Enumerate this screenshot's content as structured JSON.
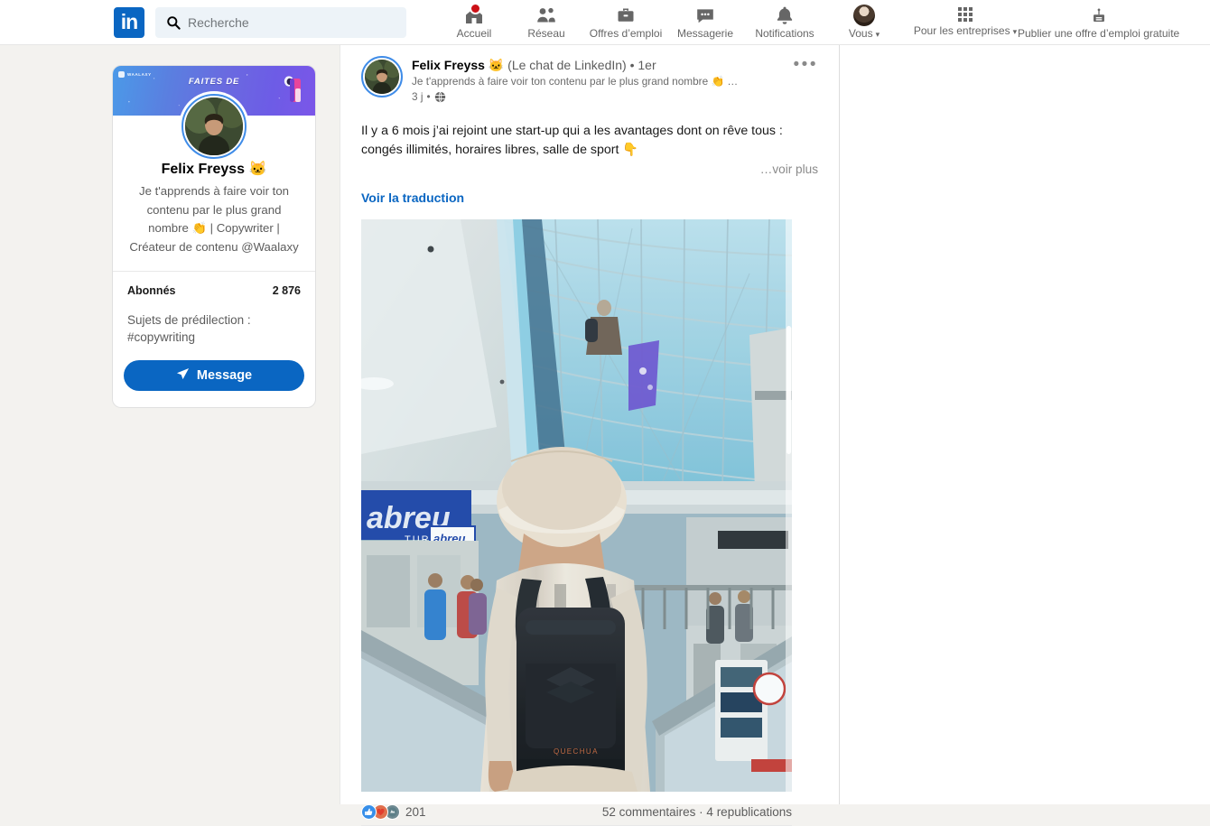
{
  "nav": {
    "logo": "in",
    "search": {
      "placeholder": "Recherche",
      "value": "",
      "icon": "search-icon"
    },
    "items": [
      {
        "label": "Accueil",
        "icon": "home-icon",
        "badge": true
      },
      {
        "label": "Réseau",
        "icon": "network-icon",
        "badge": false
      },
      {
        "label": "Offres d’emploi",
        "icon": "briefcase-icon",
        "badge": false
      },
      {
        "label": "Messagerie",
        "icon": "message-icon",
        "badge": false
      },
      {
        "label": "Notifications",
        "icon": "bell-icon",
        "badge": false
      },
      {
        "label": "Vous",
        "icon": "avatar-icon",
        "badge": false,
        "caret": "▾"
      }
    ],
    "business": {
      "label": "Pour les entreprises",
      "icon": "grid-icon",
      "caret": "▾"
    },
    "post_job": {
      "label": "Publier une offre d’emploi gratuite",
      "icon": "post-job-icon"
    }
  },
  "profile_card": {
    "banner": {
      "logo_text": "WAALAXY",
      "title": "FAITES DE",
      "icon": "astronaut-icon"
    },
    "name": "Felix Freyss 🐱",
    "headline": "Je t'apprends à faire voir ton contenu par le plus grand nombre 👏 | Copywriter | Créateur de contenu @Waalaxy",
    "stats": {
      "label": "Abonnés",
      "value": "2 876"
    },
    "topics": "Sujets de prédilection :\n#copywriting",
    "message_button": {
      "label": "Message",
      "icon": "send-icon"
    }
  },
  "post": {
    "author_name": "Felix Freyss 🐱",
    "author_suffix": "(Le chat de LinkedIn) • 1er",
    "author_headline": "Je t'apprends à faire voir ton contenu par le plus grand nombre 👏 …",
    "age": "3 j",
    "separator": "•",
    "visibility_icon": "globe-icon",
    "menu_icon": "more-options-icon",
    "body": "Il y a 6 mois j’ai rejoint une start-up qui a les avantages dont on rêve tous : congés illimités, horaires libres, salle de sport 👇",
    "see_more": "…voir plus",
    "translate": "Voir la traduction",
    "image_alt": "Personne de dos avec un sac à dos Quechua sur un escalator dans un centre commercial",
    "reactions": {
      "count": "201",
      "types": [
        "like-icon",
        "love-icon",
        "support-icon"
      ]
    },
    "engagement": "52 commentaires · 4 republications"
  },
  "colors": {
    "brand": "#0a66c2",
    "page_bg": "#f3f2ef",
    "card_bg": "#ffffff",
    "badge_red": "#cc1016",
    "text_muted": "#5c5c5c"
  }
}
